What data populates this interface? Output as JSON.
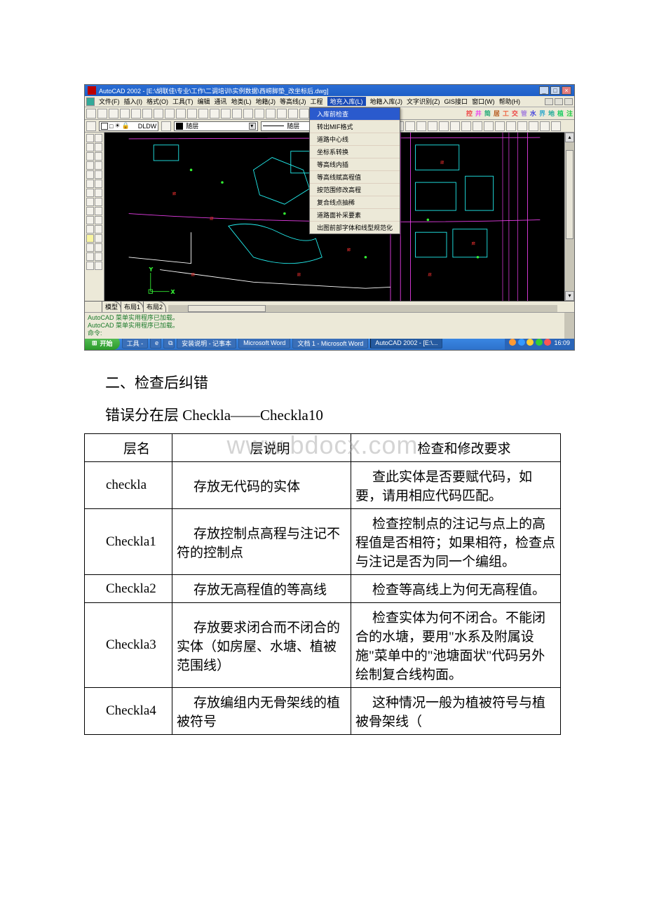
{
  "acad": {
    "title": "AutoCAD 2002 - [E:\\胡联佳\\专业\\工作\\二调培训\\实例数据\\西崂脚垫_改坐标后.dwg]",
    "menu": [
      "文件(F)",
      "插入(I)",
      "格式(O)",
      "工具(T)",
      "编辑",
      "通讯",
      "地类(L)",
      "地籍(J)",
      "等高线(J)",
      "工程",
      "地充入库(L)",
      "地籍入库(J)",
      "文字识别(Z)",
      "GIS接口",
      "窗口(W)",
      "帮助(H)"
    ],
    "menu_hl": "地充入库(L)",
    "colorbar": [
      "控",
      "井",
      "简",
      "居",
      "工",
      "交",
      "管",
      "水",
      "界",
      "地",
      "植",
      "注"
    ],
    "colorbar_colors": [
      "#e44",
      "#e4e",
      "#2a7",
      "#b6581c",
      "#e64",
      "#e44",
      "#a8d",
      "#44d",
      "#3ac",
      "#2a9",
      "#2c6",
      "#2c4"
    ],
    "layer_name": "DLDW",
    "layer_ctrl": "随层",
    "dropdown_hl": "入库前检查",
    "dropdown": [
      "入库前检查",
      "转出MIF格式",
      "道路中心线",
      "坐标系转换",
      "等高线内插",
      "等高线赋高程值",
      "按范围修改高程",
      "复合线点抽稀",
      "道路面补采要素",
      "出图前部字体和线型规范化"
    ],
    "tabs": [
      "模型",
      "布局1",
      "布局2"
    ],
    "cmd1": "AutoCAD 菜单实用程序已加载。",
    "cmd2": "AutoCAD 菜单实用程序已加载。",
    "cmd3": "命令:",
    "taskbar": {
      "start": "开始",
      "items": [
        "工具 - ",
        "",
        "",
        "安装说明 - 记事本",
        "Microsoft Word",
        "文档 1 - Microsoft Word",
        "AutoCAD 2002 - [E:\\..."
      ],
      "active_index": 6,
      "time": "16:09"
    }
  },
  "doc": {
    "heading": "二、检查后纠错",
    "subline": "错误分在层 Checkla——Checkla10",
    "watermark": "www.bdocx.com",
    "table": {
      "headers": [
        "层名",
        "层说明",
        "检查和修改要求"
      ],
      "rows": [
        {
          "c1": "checkla",
          "c2": "存放无代码的实体",
          "c3": "查此实体是否要赋代码，如要，请用相应代码匹配。"
        },
        {
          "c1": "Checkla1",
          "c2": "存放控制点高程与注记不符的控制点",
          "c3": "检查控制点的注记与点上的高程值是否相符；如果相符，检查点与注记是否为同一个编组。"
        },
        {
          "c1": "Checkla2",
          "c2": "存放无高程值的等高线",
          "c3": "检查等高线上为何无高程值。"
        },
        {
          "c1": "Checkla3",
          "c2": "存放要求闭合而不闭合的实体（如房屋、水塘、植被范围线）",
          "c3": "检查实体为何不闭合。不能闭合的水塘，要用\"水系及附属设施\"菜单中的\"池塘面状\"代码另外绘制复合线构面。"
        },
        {
          "c1": "Checkla4",
          "c2": "存放编组内无骨架线的植被符号",
          "c3": "这种情况一般为植被符号与植被骨架线（"
        }
      ]
    }
  }
}
